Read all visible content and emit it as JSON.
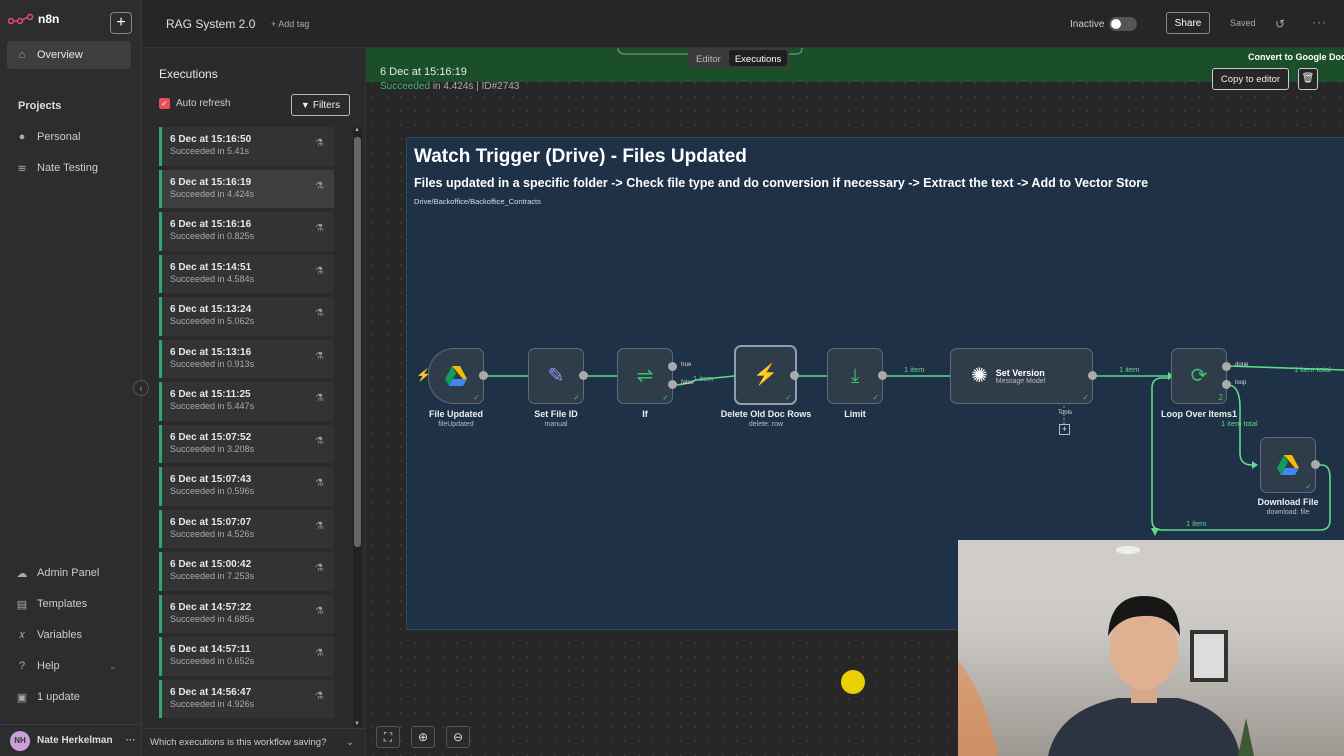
{
  "app": {
    "logo": "n8n"
  },
  "sidebar": {
    "overview": "Overview",
    "projects_title": "Projects",
    "projects": [
      "Personal",
      "Nate Testing"
    ],
    "bottom_items": [
      "Admin Panel",
      "Templates",
      "Variables",
      "Help",
      "1 update"
    ],
    "user": {
      "initials": "NH",
      "name": "Nate Herkelman"
    }
  },
  "header": {
    "workflow_name": "RAG System 2.0",
    "add_tag": "+ Add tag",
    "inactive_label": "Inactive",
    "share": "Share",
    "saved": "Saved"
  },
  "executions": {
    "title": "Executions",
    "auto_refresh": "Auto refresh",
    "filters": "Filters",
    "footer": "Which executions is this workflow saving?",
    "items": [
      {
        "date": "6 Dec at 15:16:50",
        "status": "Succeeded in 5.41s"
      },
      {
        "date": "6 Dec at 15:16:19",
        "status": "Succeeded in 4.424s"
      },
      {
        "date": "6 Dec at 15:16:16",
        "status": "Succeeded in 0.825s"
      },
      {
        "date": "6 Dec at 15:14:51",
        "status": "Succeeded in 4.584s"
      },
      {
        "date": "6 Dec at 15:13:24",
        "status": "Succeeded in 5.062s"
      },
      {
        "date": "6 Dec at 15:13:16",
        "status": "Succeeded in 0.913s"
      },
      {
        "date": "6 Dec at 15:11:25",
        "status": "Succeeded in 5.447s"
      },
      {
        "date": "6 Dec at 15:07:52",
        "status": "Succeeded in 3.208s"
      },
      {
        "date": "6 Dec at 15:07:43",
        "status": "Succeeded in 0.596s"
      },
      {
        "date": "6 Dec at 15:07:07",
        "status": "Succeeded in 4.526s"
      },
      {
        "date": "6 Dec at 15:00:42",
        "status": "Succeeded in 7.253s"
      },
      {
        "date": "6 Dec at 14:57:22",
        "status": "Succeeded in 4.685s"
      },
      {
        "date": "6 Dec at 14:57:11",
        "status": "Succeeded in 0.652s"
      },
      {
        "date": "6 Dec at 14:56:47",
        "status": "Succeeded in 4.926s"
      }
    ]
  },
  "canvas": {
    "tabs": [
      "Editor",
      "Executions"
    ],
    "run_date": "6 Dec at 15:16:19",
    "run_status_ok": "Succeeded",
    "run_status_rest": " in 4.424s | ID#2743",
    "convert_label": "Convert to Google Doc",
    "copy_to_editor": "Copy to editor",
    "sticky": {
      "title": "Watch Trigger (Drive) - Files Updated",
      "subtitle": "Files updated in a specific folder -> Check file type and do conversion if necessary -> Extract the text -> Add to Vector Store",
      "path": "Drive/Backoffice/Backoffice_Contracts"
    },
    "nodes": [
      {
        "name": "File Updated",
        "sub": "fileUpdated",
        "icon": "google-drive-icon"
      },
      {
        "name": "Set File ID",
        "sub": "manual",
        "icon": "pencil-icon"
      },
      {
        "name": "If",
        "sub": "",
        "icon": "if-branch-icon"
      },
      {
        "name": "Delete Old Doc Rows",
        "sub": "delete: row",
        "icon": "bolt-icon"
      },
      {
        "name": "Limit",
        "sub": "",
        "icon": "limit-icon"
      },
      {
        "name": "Set Version",
        "sub": "Message Model",
        "icon": "openai-icon"
      },
      {
        "name": "Loop Over Items1",
        "sub": "",
        "icon": "loop-icon"
      },
      {
        "name": "Download File",
        "sub": "download: file",
        "icon": "google-drive-icon"
      }
    ],
    "labels": {
      "true": "true",
      "false": "false",
      "one_item": "1 item",
      "done": "done",
      "loop": "loop",
      "tools": "Tools",
      "one_item_total": "1 item total",
      "loop_count": "2"
    }
  },
  "colors": {
    "success": "#2ea86b",
    "accent": "#e74c5b",
    "sticky": "#1f3147"
  }
}
